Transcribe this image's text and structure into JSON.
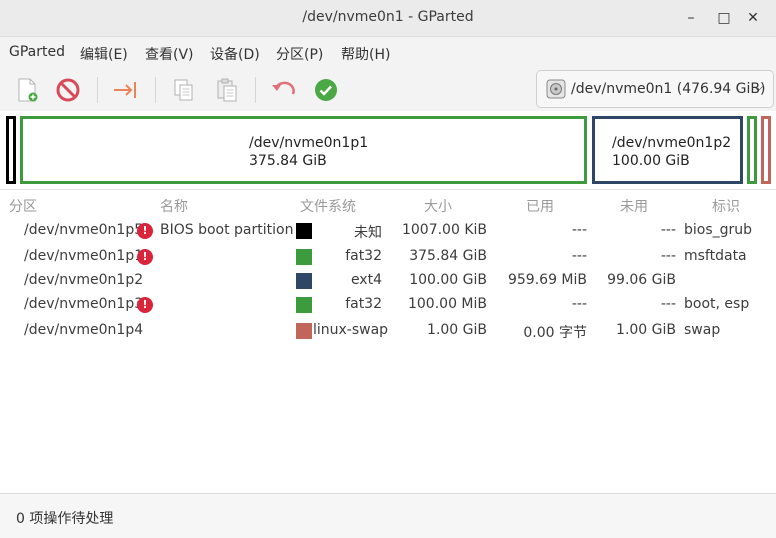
{
  "window": {
    "title": "/dev/nvme0n1 - GParted",
    "minimize": "–",
    "maximize": "□",
    "close": "✕"
  },
  "menu": [
    "GParted",
    "编辑(E)",
    "查看(V)",
    "设备(D)",
    "分区(P)",
    "帮助(H)"
  ],
  "toolbar": {
    "icons": [
      "new-icon",
      "delete-icon",
      "resize-move-icon",
      "copy-icon",
      "paste-icon",
      "undo-icon",
      "apply-icon"
    ],
    "device": "/dev/nvme0n1 (476.94 GiB)"
  },
  "diskmap": [
    {
      "name": "/dev/nvme0n1p1",
      "size": "375.84 GiB",
      "color": "#3d9a3d"
    },
    {
      "name": "/dev/nvme0n1p2",
      "size": "100.00 GiB",
      "color": "#2e4766"
    }
  ],
  "colors": {
    "p5": "#000000",
    "p1": "#3d9a3d",
    "p2": "#2e4766",
    "p3": "#3d9a3d",
    "p4": "#c1665a",
    "p2_small": "#2e4766"
  },
  "table": {
    "headers": [
      "分区",
      "名称",
      "文件系统",
      "大小",
      "已用",
      "未用",
      "标识"
    ],
    "rows": [
      {
        "partition": "/dev/nvme0n1p5",
        "warn": true,
        "name": "BIOS boot partition",
        "color": "#000000",
        "fs": "未知",
        "size": "1007.00 KiB",
        "used": "---",
        "unused": "---",
        "flags": "bios_grub"
      },
      {
        "partition": "/dev/nvme0n1p1",
        "warn": true,
        "name": "",
        "color": "#3d9a3d",
        "fs": "fat32",
        "size": "375.84 GiB",
        "used": "---",
        "unused": "---",
        "flags": "msftdata"
      },
      {
        "partition": "/dev/nvme0n1p2",
        "warn": false,
        "name": "",
        "color": "#2e4766",
        "fs": "ext4",
        "size": "100.00 GiB",
        "used": "959.69 MiB",
        "unused": "99.06 GiB",
        "flags": ""
      },
      {
        "partition": "/dev/nvme0n1p3",
        "warn": true,
        "name": "",
        "color": "#3d9a3d",
        "fs": "fat32",
        "size": "100.00 MiB",
        "used": "---",
        "unused": "---",
        "flags": "boot, esp"
      },
      {
        "partition": "/dev/nvme0n1p4",
        "warn": false,
        "name": "",
        "color": "#c1665a",
        "fs": "linux-swap",
        "size": "1.00 GiB",
        "used": "0.00 字节",
        "unused": "1.00 GiB",
        "flags": "swap"
      }
    ]
  },
  "status": "0 项操作待处理"
}
